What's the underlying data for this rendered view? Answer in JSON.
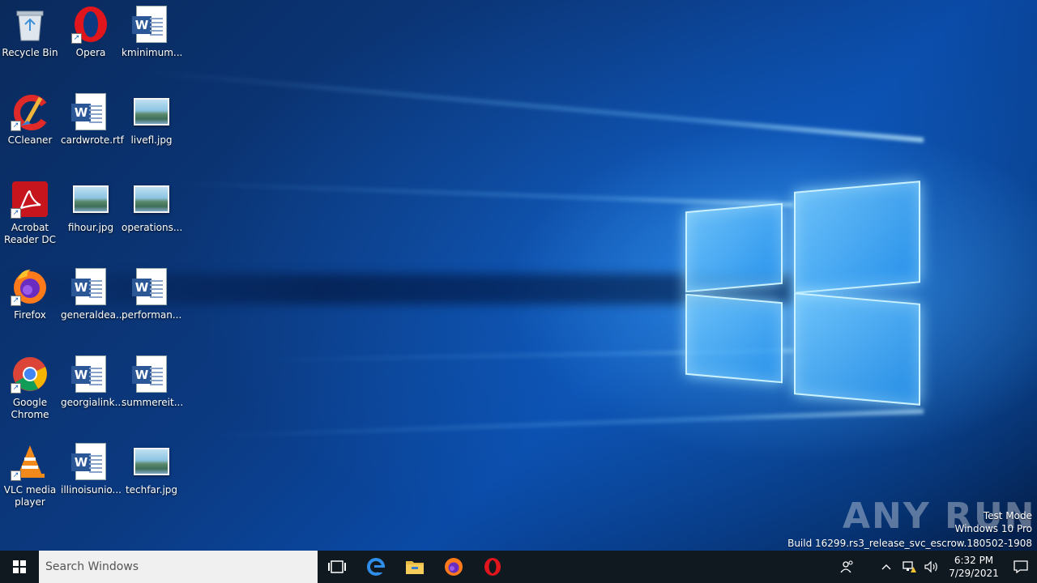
{
  "desktop": {
    "icons": [
      {
        "label": "Recycle Bin",
        "type": "recycle",
        "shortcut": false
      },
      {
        "label": "Opera",
        "type": "opera",
        "shortcut": true
      },
      {
        "label": "kminimum...",
        "type": "word",
        "shortcut": false
      },
      {
        "label": "CCleaner",
        "type": "ccleaner",
        "shortcut": true
      },
      {
        "label": "cardwrote.rtf",
        "type": "word",
        "shortcut": false
      },
      {
        "label": "livefl.jpg",
        "type": "image",
        "shortcut": false
      },
      {
        "label": "Acrobat Reader DC",
        "type": "acrobat",
        "shortcut": true
      },
      {
        "label": "fihour.jpg",
        "type": "image",
        "shortcut": false
      },
      {
        "label": "operations...",
        "type": "image",
        "shortcut": false
      },
      {
        "label": "Firefox",
        "type": "firefox",
        "shortcut": true
      },
      {
        "label": "generaldea...",
        "type": "word",
        "shortcut": false
      },
      {
        "label": "performan...",
        "type": "word",
        "shortcut": false
      },
      {
        "label": "Google Chrome",
        "type": "chrome",
        "shortcut": true
      },
      {
        "label": "georgialink...",
        "type": "word",
        "shortcut": false
      },
      {
        "label": "summereit...",
        "type": "word",
        "shortcut": false
      },
      {
        "label": "VLC media player",
        "type": "vlc",
        "shortcut": true
      },
      {
        "label": "illinoisunio...",
        "type": "word",
        "shortcut": false
      },
      {
        "label": "techfar.jpg",
        "type": "image",
        "shortcut": false
      }
    ]
  },
  "watermark": {
    "brand": "ANY RUN",
    "line1": "Test Mode",
    "line2": "Windows 10 Pro",
    "line3": "Build 16299.rs3_release_svc_escrow.180502-1908"
  },
  "taskbar": {
    "search_placeholder": "Search Windows",
    "clock_time": "6:32 PM",
    "clock_date": "7/29/2021"
  }
}
